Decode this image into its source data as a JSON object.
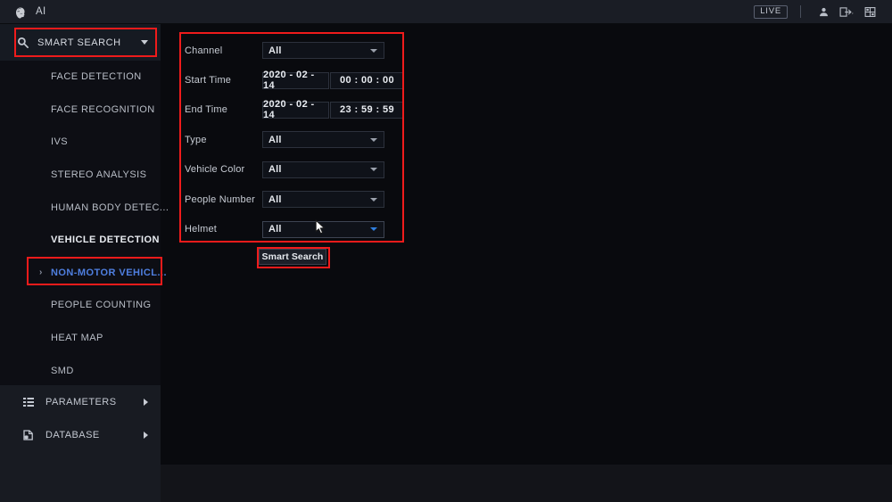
{
  "topbar": {
    "app_icon": "ai-face-icon",
    "title": "AI",
    "live_label": "LIVE",
    "icons": [
      {
        "name": "user-icon",
        "label": "user"
      },
      {
        "name": "logout-icon",
        "label": "logout"
      },
      {
        "name": "layout-grid-icon",
        "label": "layout"
      }
    ]
  },
  "sidebar": {
    "header": {
      "icon": "smart-search-icon",
      "label": "SMART SEARCH",
      "caret": "chevron-down-icon"
    },
    "items": [
      {
        "label": "FACE DETECTION",
        "state": "normal"
      },
      {
        "label": "FACE RECOGNITION",
        "state": "normal"
      },
      {
        "label": "IVS",
        "state": "normal"
      },
      {
        "label": "STEREO ANALYSIS",
        "state": "normal"
      },
      {
        "label": "HUMAN BODY DETEC...",
        "state": "normal"
      },
      {
        "label": "VEHICLE DETECTION",
        "state": "bold"
      },
      {
        "label": "NON-MOTOR VEHICL...",
        "state": "active",
        "arrow": "›"
      },
      {
        "label": "PEOPLE COUNTING",
        "state": "normal"
      },
      {
        "label": "HEAT MAP",
        "state": "normal"
      },
      {
        "label": "SMD",
        "state": "normal"
      }
    ],
    "footer_items": [
      {
        "label": "PARAMETERS",
        "icon": "list-icon",
        "caret": "chevron-right-icon"
      },
      {
        "label": "DATABASE",
        "icon": "database-icon",
        "caret": "chevron-right-icon"
      }
    ]
  },
  "form": {
    "rows": [
      {
        "label": "Channel",
        "type": "select",
        "value": "All"
      },
      {
        "label": "Start Time",
        "type": "datetime",
        "date": "2020 - 02 - 14",
        "time": "00 : 00 : 00"
      },
      {
        "label": "End Time",
        "type": "datetime",
        "date": "2020 - 02 - 14",
        "time": "23 : 59 : 59"
      },
      {
        "label": "Type",
        "type": "select",
        "value": "All"
      },
      {
        "label": "Vehicle Color",
        "type": "select",
        "value": "All"
      },
      {
        "label": "People Number",
        "type": "select",
        "value": "All"
      },
      {
        "label": "Helmet",
        "type": "select",
        "value": "All",
        "hover": true
      }
    ],
    "submit_label": "Smart Search"
  },
  "colors": {
    "annotation_red": "#ef1b1b",
    "accent_blue": "#4f7fe0",
    "background": "#0b0c10",
    "sidebar": "#0d0e14",
    "topbar": "#1a1d25"
  }
}
